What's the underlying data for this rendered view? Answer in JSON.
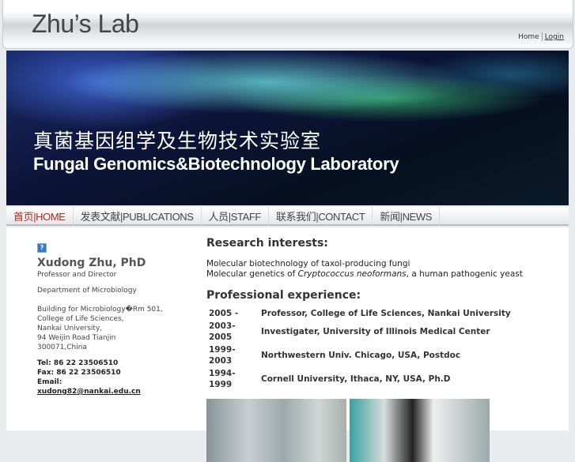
{
  "header": {
    "logo": "Zhu’s Lab",
    "links": [
      "Home",
      "Login"
    ]
  },
  "banner": {
    "title_cn": "真菌基因组学及生物技术实验室",
    "title_en": "Fungal Genomics&Biotechnology Laboratory"
  },
  "nav": [
    {
      "label": "首页|HOME",
      "active": true
    },
    {
      "label": "发表文献|PUBLICATIONS"
    },
    {
      "label": "人员|STAFF"
    },
    {
      "label": "联系我们|CONTACT"
    },
    {
      "label": "新闻|NEWS"
    }
  ],
  "profile": {
    "icon": "?",
    "name": "Xudong Zhu, PhD",
    "title": "Professor and Director",
    "department": "Department of Microbiology",
    "address": [
      "Building for Microbiology�Rm 501,",
      "College of Life Sciences,",
      "Nankai University,",
      "94 Weijin Road Tianjin",
      "300071,China"
    ],
    "tel": "Tel:  86 22 23506510",
    "fax": "Fax:  86 22 23506510",
    "email_label": "Email:",
    "email": "xudong82@nankai.edu.cn"
  },
  "research": {
    "heading": "Research interests:",
    "line1": "Molecular biotechnology of taxol-producing fungi",
    "line2_pre": "Molecular genetics of ",
    "line2_italic": "Cryptococcus neoformans",
    "line2_post": ", a human pathogenic yeast"
  },
  "experience": {
    "heading": "Professional experience:",
    "rows": [
      {
        "years": "2005 -",
        "desc": "Professor, College of Life Sciences, Nankai University"
      },
      {
        "years": "2003-2005",
        "desc": "Investigater, University of Illinois Medical Center"
      },
      {
        "years": "1999-2003",
        "desc": "Northwestern Univ. Chicago, USA, Postdoc"
      },
      {
        "years": "1994-1999",
        "desc": "Cornell University, Ithaca, NY, USA, Ph.D"
      }
    ]
  }
}
